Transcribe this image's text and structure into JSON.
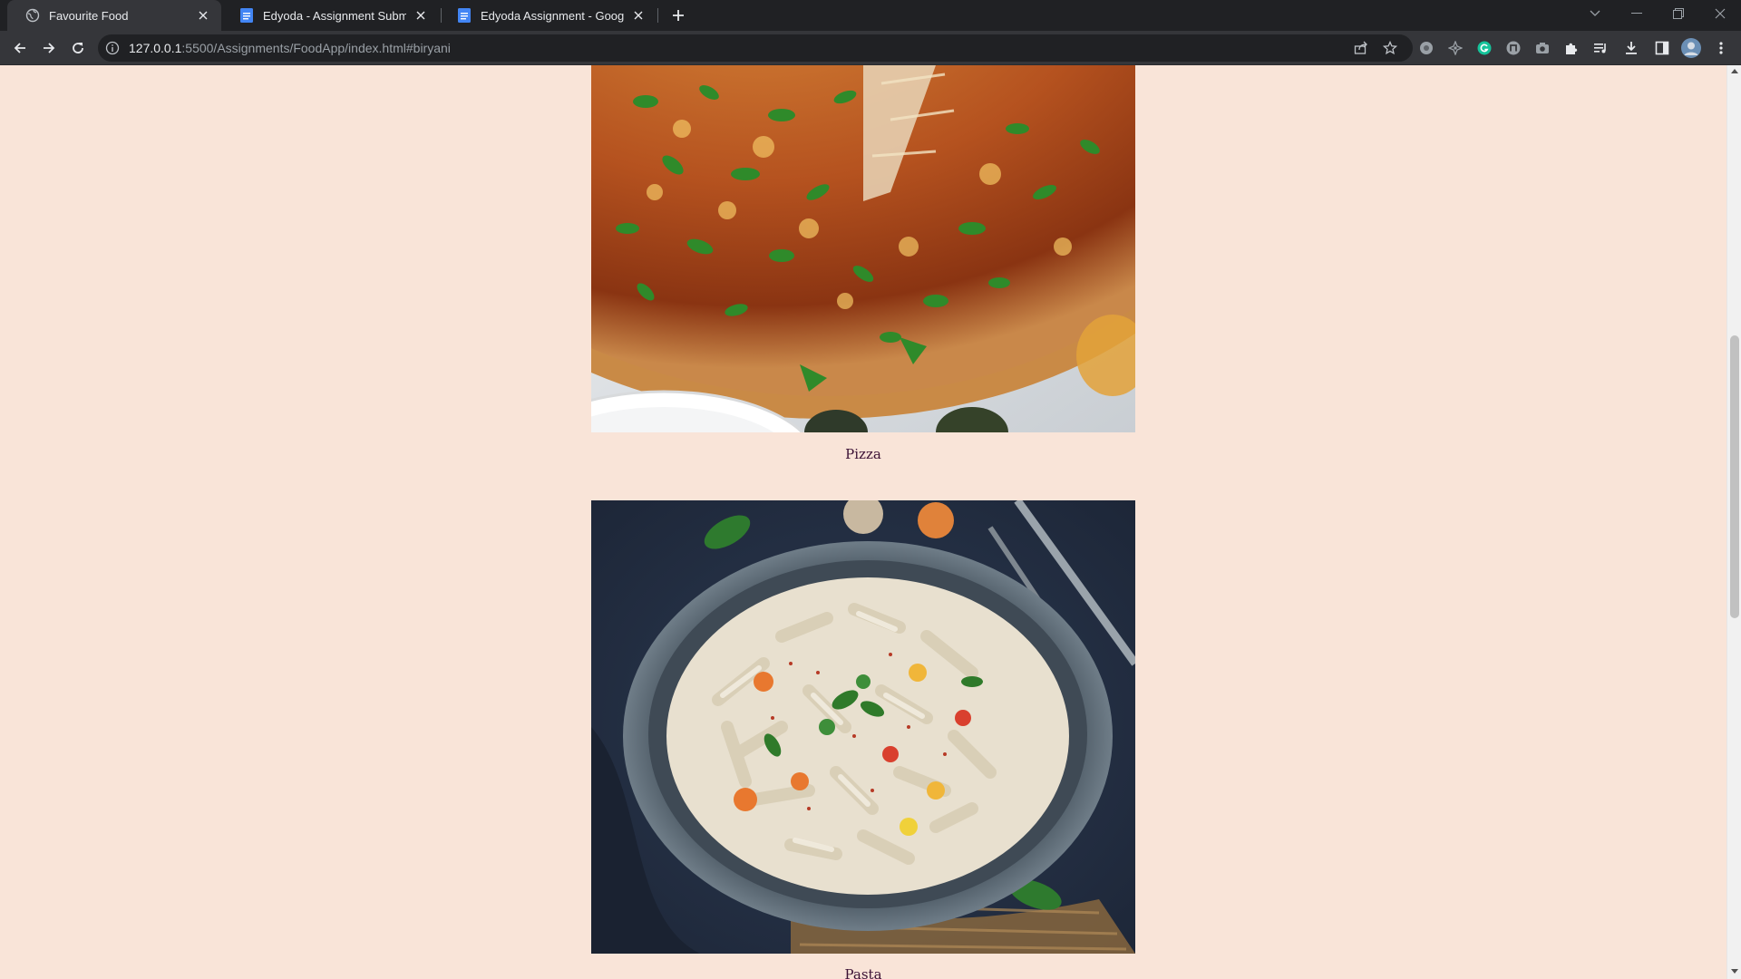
{
  "browser": {
    "tabs": [
      {
        "title": "Favourite Food",
        "favicon": "globe-icon",
        "active": true
      },
      {
        "title": "Edyoda - Assignment Submission",
        "favicon": "google-docs-icon",
        "active": false
      },
      {
        "title": "Edyoda Assignment - Google Docs",
        "favicon": "google-docs-icon",
        "active": false
      }
    ],
    "new_tab_icon": "plus-icon",
    "url_host": "127.0.0.1",
    "url_path": ":5500/Assignments/FoodApp/index.html#biryani",
    "extensions": [
      "share-icon",
      "star-icon",
      "extension-gray-icon",
      "extension-compass-icon",
      "grammarly-icon",
      "extension-n-icon",
      "camera-icon",
      "puzzle-icon",
      "media-queue-icon",
      "download-icon",
      "side-panel-icon",
      "profile-avatar",
      "more-vert-icon"
    ]
  },
  "page": {
    "background": "#f9e4d8",
    "items": [
      {
        "name": "Pizza",
        "image": "pizza-photo"
      },
      {
        "name": "Pasta",
        "image": "pasta-photo"
      }
    ]
  }
}
